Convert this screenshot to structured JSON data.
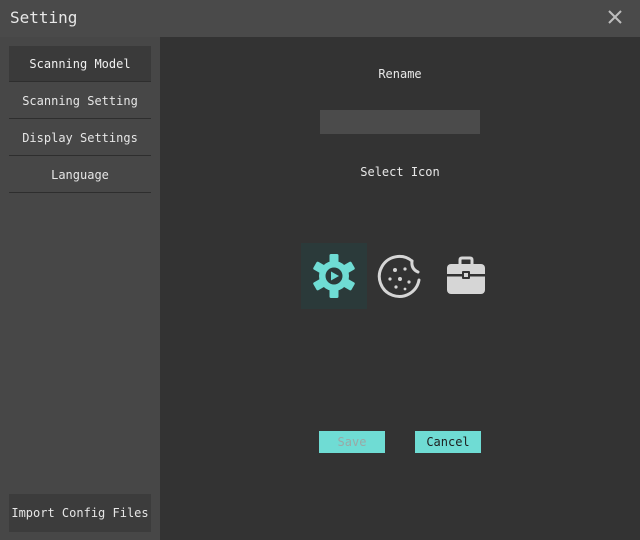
{
  "window": {
    "title": "Setting"
  },
  "sidebar": {
    "items": [
      {
        "label": "Scanning Model"
      },
      {
        "label": "Scanning Setting"
      },
      {
        "label": "Display Settings"
      },
      {
        "label": "Language"
      }
    ],
    "import_label": "Import Config Files"
  },
  "main": {
    "rename_label": "Rename",
    "rename_value": "",
    "select_icon_label": "Select Icon",
    "icons": [
      "gear-play-icon",
      "cookie-icon",
      "toolbox-icon"
    ],
    "save_label": "Save",
    "cancel_label": "Cancel"
  },
  "colors": {
    "accent": "#6fdcd4",
    "sidebar_bg": "#474747",
    "main_bg": "#333333"
  }
}
